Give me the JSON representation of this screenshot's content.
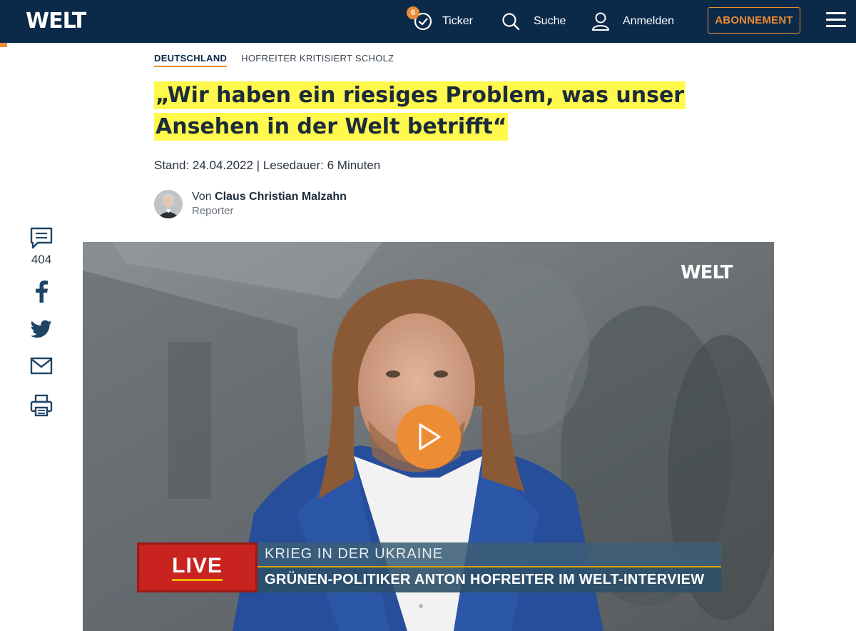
{
  "header": {
    "logo": "WELT",
    "ticker_badge": "6",
    "ticker_label": "Ticker",
    "search_label": "Suche",
    "login_label": "Anmelden",
    "subscribe_label": "ABONNEMENT"
  },
  "article": {
    "section": "DEUTSCHLAND",
    "topic": "HOFREITER KRITISIERT SCHOLZ",
    "headline": "„Wir haben ein riesiges Problem, was unser Ansehen in der Welt betrifft“",
    "meta": "Stand: 24.04.2022 | Lesedauer: 6 Minuten",
    "author_prefix": "Von ",
    "author_name": "Claus Christian Malzahn",
    "author_role": "Reporter"
  },
  "share": {
    "comment_count": "404"
  },
  "video": {
    "watermark": "WELT",
    "live_label": "LIVE",
    "ticker_line1": "KRIEG IN DER UKRAINE",
    "ticker_line2": "GRÜNEN-POLITIKER ANTON HOFREITER IM WELT-INTERVIEW"
  },
  "colors": {
    "header_bg": "#0b2a4a",
    "accent": "#ec8c35",
    "highlight": "#fff94d",
    "live_red": "#c8231e"
  }
}
